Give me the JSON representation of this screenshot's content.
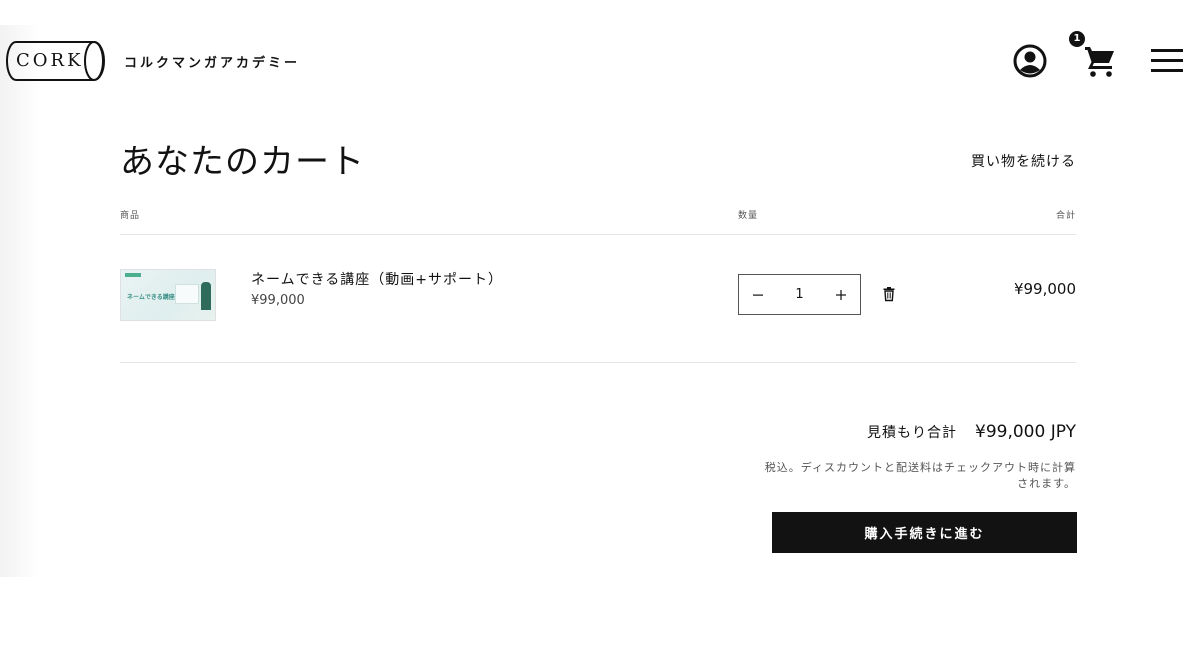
{
  "header": {
    "logo_text": "CORK",
    "site_name": "コルクマンガアカデミー",
    "cart_count": "1"
  },
  "cart": {
    "title": "あなたのカート",
    "continue_label": "買い物を続ける",
    "columns": {
      "product": "商品",
      "quantity": "数量",
      "total": "合計"
    },
    "items": [
      {
        "thumb_text": "ネームできる講座",
        "name": "ネームできる講座（動画+サポート）",
        "price": "¥99,000",
        "quantity": "1",
        "line_total": "¥99,000"
      }
    ],
    "subtotal_label": "見積もり合計",
    "subtotal_value": "¥99,000 JPY",
    "tax_note": "税込。ディスカウントと配送料はチェックアウト時に計算されます。",
    "checkout_label": "購入手続きに進む"
  },
  "icons": {
    "account": "account-icon",
    "cart": "cart-icon",
    "menu": "menu-icon",
    "trash": "trash-icon",
    "minus": "minus-icon",
    "plus": "plus-icon"
  },
  "colors": {
    "text": "#121212",
    "button_bg": "#121212",
    "button_text": "#ffffff",
    "rule": "#e6e6e6"
  }
}
